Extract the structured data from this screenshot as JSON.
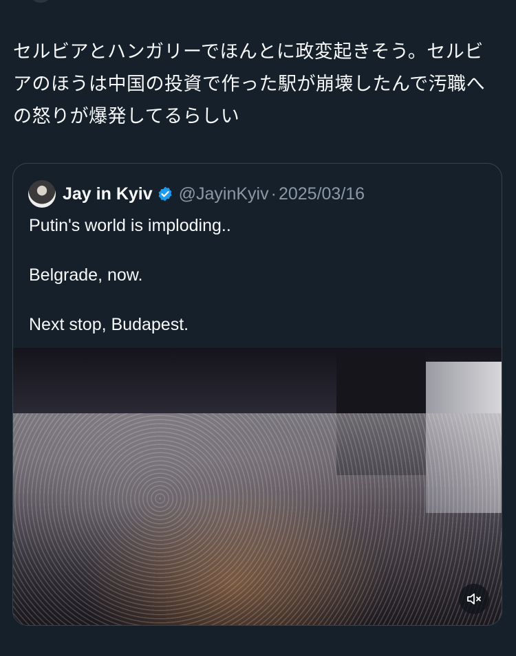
{
  "tweet": {
    "text": "セルビアとハンガリーでほんとに政変起きそう。セルビアのほうは中国の投資で作った駅が崩壊したんで汚職への怒りが爆発してるらしい"
  },
  "quote": {
    "display_name": "Jay in Kyiv",
    "handle": "@JayinKyiv",
    "separator": "·",
    "date": "2025/03/16",
    "body": [
      "Putin's world is imploding..",
      "Belgrade, now.",
      "Next stop, Budapest."
    ],
    "verified_color": "#1d9bf0"
  },
  "media": {
    "mute_icon": "speaker-muted-icon"
  },
  "colors": {
    "background": "#15202b",
    "text": "#f7f9f9",
    "secondary": "#8b98a5",
    "border": "#38444d"
  }
}
